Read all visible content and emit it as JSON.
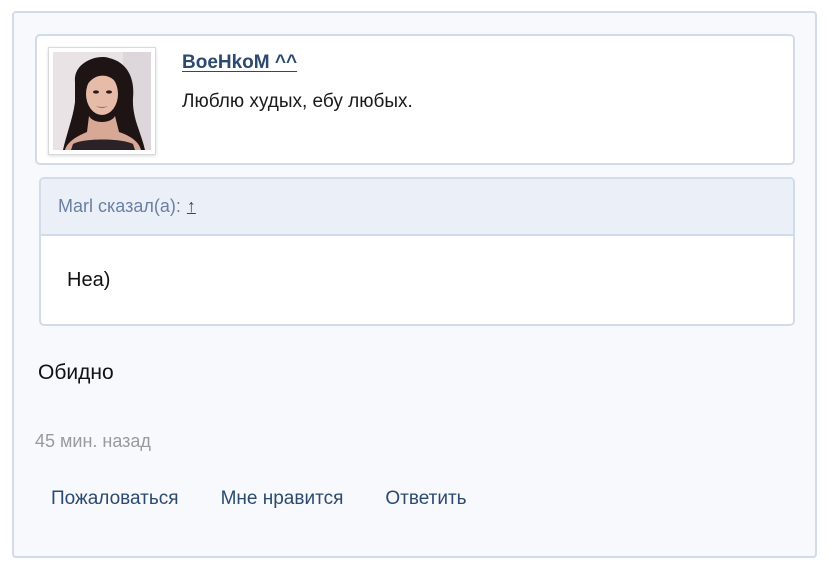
{
  "author": {
    "username": "BoeHkoM ^^",
    "status": "Люблю худых, ебу любых.",
    "avatar_icon": "user-avatar-photo"
  },
  "quote": {
    "header": "Marl сказал(а):",
    "jump_glyph": "↑",
    "body": "Hea)"
  },
  "comment": {
    "text": "Обидно",
    "timestamp": "45 мин. назад"
  },
  "actions": {
    "report": "Пожаловаться",
    "like": "Мне нравится",
    "reply": "Ответить"
  },
  "colors": {
    "link": "#2b4a6e",
    "border": "#d2dbea",
    "quote_header_bg": "#ebf0f8",
    "muted_text": "#9a9a9a"
  }
}
